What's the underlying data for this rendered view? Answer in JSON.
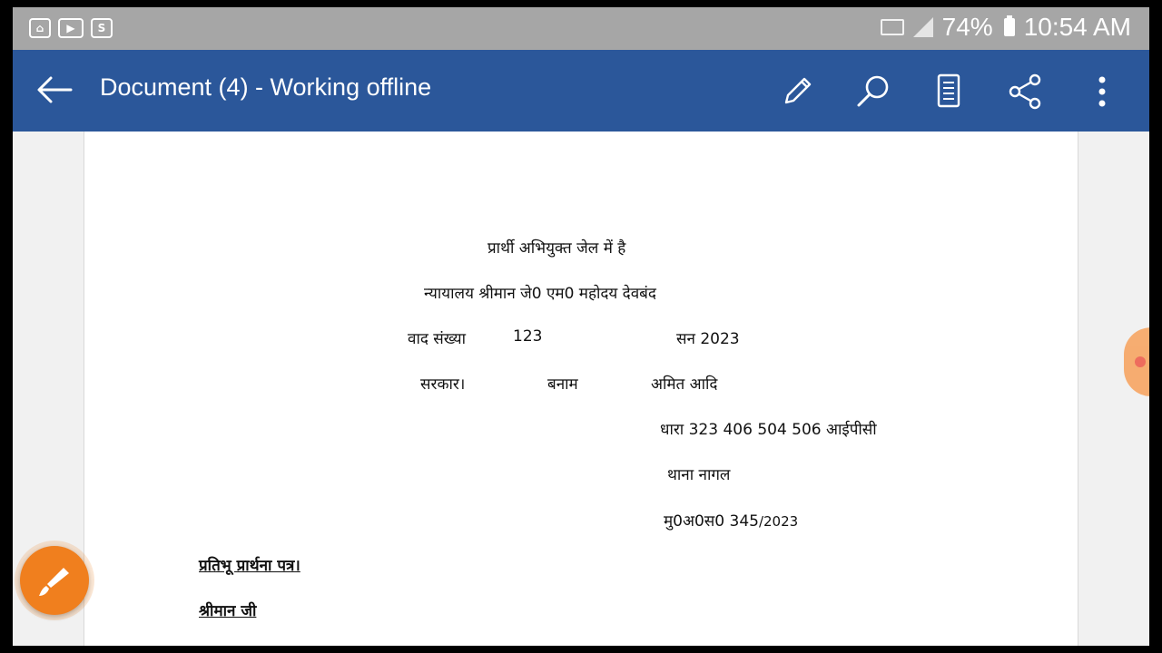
{
  "status_bar": {
    "battery": "74%",
    "time": "10:54 AM",
    "left_icons": [
      "bag-icon",
      "video-icon",
      "s-app-icon"
    ]
  },
  "app_bar": {
    "title": "Document (4) - Working offline",
    "actions": [
      "edit-icon",
      "search-icon",
      "reading-view-icon",
      "share-icon",
      "more-icon"
    ]
  },
  "document": {
    "line1": "प्रार्थी अभियुक्त जेल में है",
    "line2": "न्यायालय श्रीमान जे0 एम0 महोदय देवबंद",
    "case_label": "वाद संख्या",
    "case_number": "123",
    "year_label": "सन 2023",
    "party1": "सरकार।",
    "versus": "बनाम",
    "party2": "अमित आदि",
    "sections": "धारा 323 406 504 506 आईपीसी",
    "police_station": "थाना नागल",
    "case_ref": "मु0अ0स0 345",
    "case_ref_year": "/2023",
    "heading": "प्रतिभू प्रार्थना पत्र।",
    "salutation": "श्रीमान जी"
  },
  "colors": {
    "app_bar": "#2b579a",
    "status_bar": "#a6a6a6",
    "fab": "#f07f1e"
  }
}
